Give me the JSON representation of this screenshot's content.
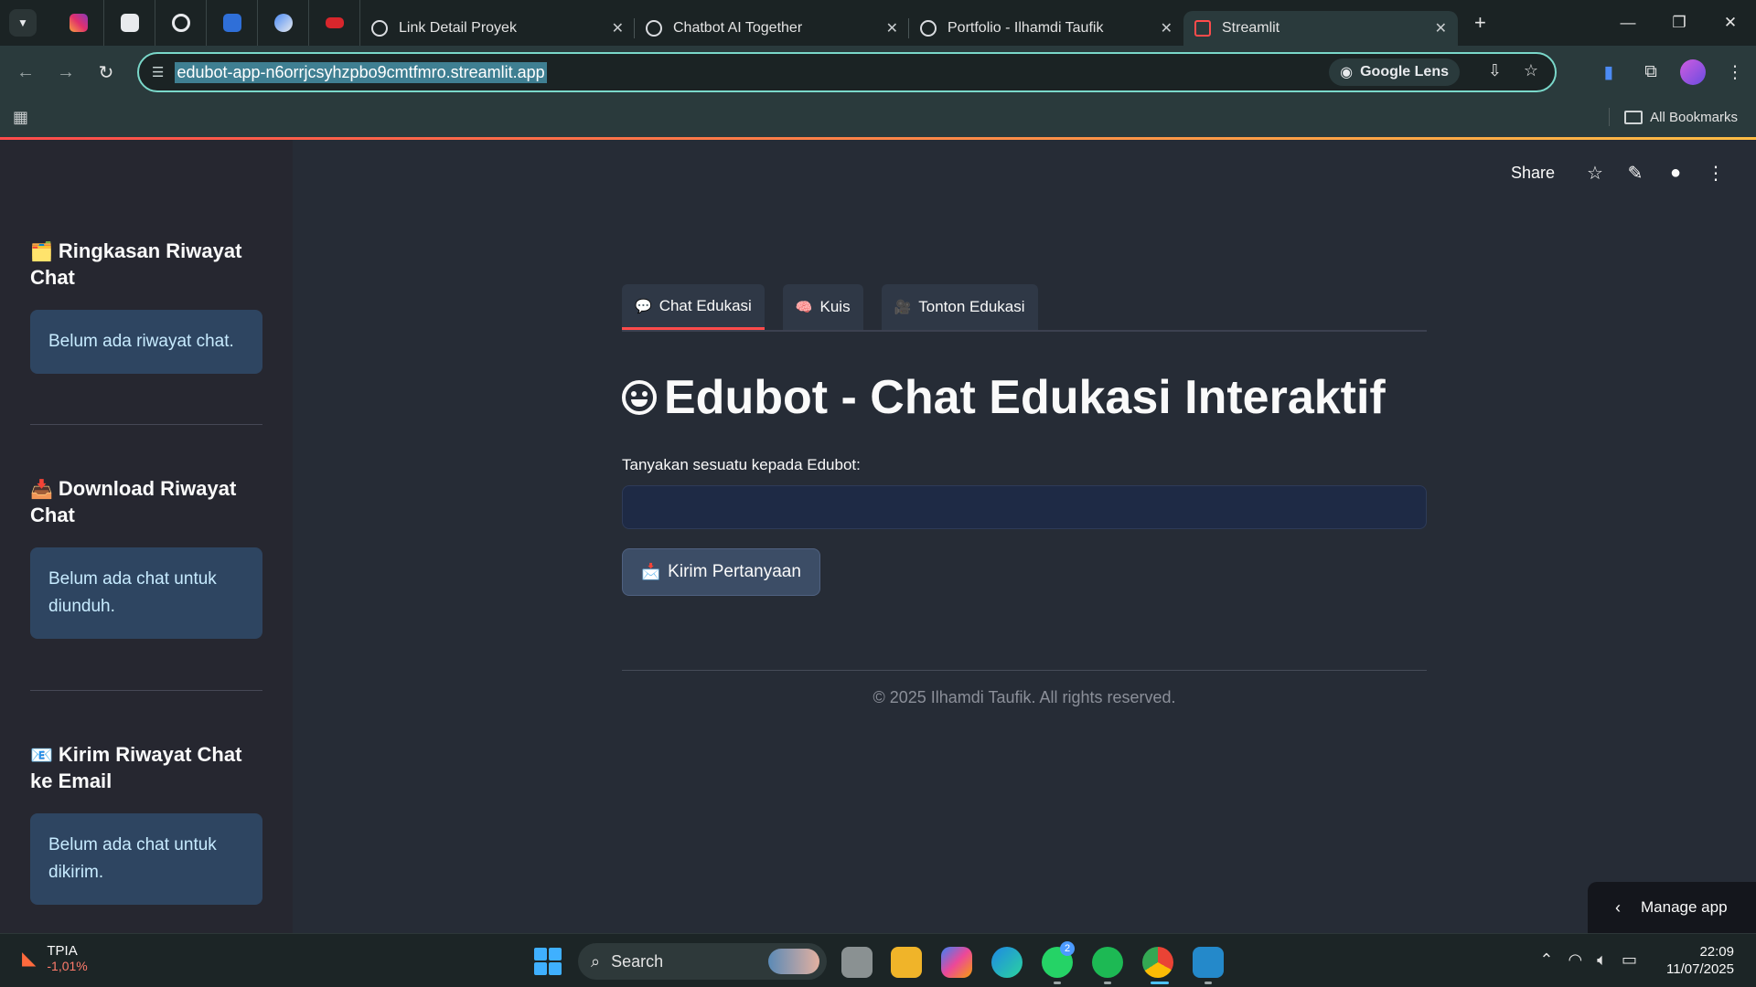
{
  "browser": {
    "tabs": [
      {
        "title": "Link Detail Proyek",
        "active": false
      },
      {
        "title": "Chatbot AI Together",
        "active": false
      },
      {
        "title": "Portfolio - Ilhamdi Taufik",
        "active": false
      },
      {
        "title": "Streamlit",
        "active": true
      }
    ],
    "pinned_icons": [
      "instagram-icon",
      "app-icon",
      "github-icon",
      "doc-icon",
      "ai-icon",
      "crown-icon"
    ],
    "url": "edubot-app-n6orrjcsyhzpbo9cmtfmro.streamlit.app",
    "google_lens_label": "Google Lens",
    "all_bookmarks_label": "All Bookmarks"
  },
  "app_header": {
    "share_label": "Share"
  },
  "sidebar": {
    "sections": [
      {
        "emoji": "🗂️",
        "title": "Ringkasan Riwayat Chat",
        "message": "Belum ada riwayat chat."
      },
      {
        "emoji": "📥",
        "title": "Download Riwayat Chat",
        "message": "Belum ada chat untuk diunduh."
      },
      {
        "emoji": "📧",
        "title": "Kirim Riwayat Chat ke Email",
        "message": "Belum ada chat untuk dikirim."
      }
    ]
  },
  "main": {
    "tabs": [
      {
        "emoji": "💬",
        "label": "Chat Edukasi",
        "active": true
      },
      {
        "emoji": "🧠",
        "label": "Kuis",
        "active": false
      },
      {
        "emoji": "🎥",
        "label": "Tonton Edukasi",
        "active": false
      }
    ],
    "title": "Edubot - Chat Edukasi Interaktif",
    "input_label": "Tanyakan sesuatu kepada Edubot:",
    "input_value": "",
    "send_emoji": "📩",
    "send_label": "Kirim Pertanyaan",
    "footer": "© 2025 Ilhamdi Taufik. All rights reserved.",
    "manage_app_label": "Manage app"
  },
  "taskbar": {
    "stock_name": "TPIA",
    "stock_change": "-1,01%",
    "search_label": "Search",
    "whatsapp_badge": "2",
    "time": "22:09",
    "date": "11/07/2025"
  },
  "colors": {
    "accent": "#ff4b4b",
    "sidebar_bg": "#262730",
    "main_bg": "#262c36",
    "info_bg": "#2e4561",
    "omnibox_border": "#7ad8ca"
  }
}
